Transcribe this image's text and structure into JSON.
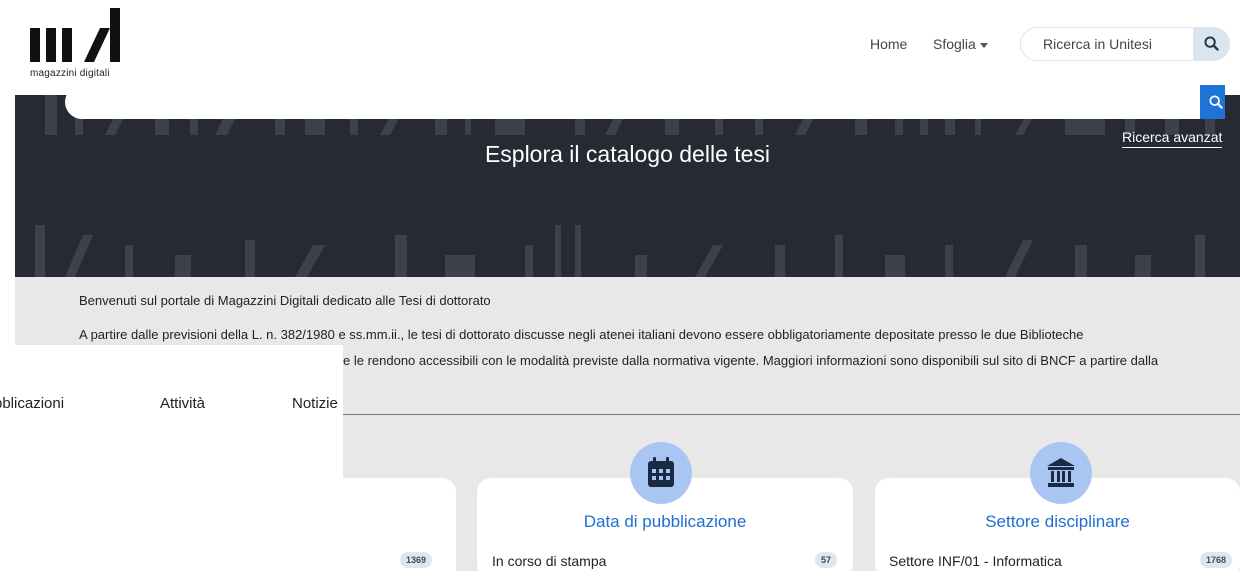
{
  "header": {
    "logo_text": "magazzini  digitali",
    "nav": {
      "home": "Home",
      "sfoglia": "Sfoglia"
    },
    "search_placeholder": "Ricerca in Unitesi"
  },
  "hero": {
    "title": "Esplora il catalogo delle tesi",
    "search_value": "",
    "advanced_link": "Ricerca avanzat"
  },
  "intro": {
    "line1": "Benvenuti sul portale di Magazzini Digitali dedicato alle Tesi di dottorato",
    "line2": "A partire dalle previsioni della L. n. 382/1980 e ss.mm.ii., le tesi di dottorato discusse negli atenei italiani devono essere obbligatoriamente depositate presso le due Biblioteche",
    "line3": "e le rendono accessibili con le modalità previste dalla normativa vigente. Maggiori informazioni sono disponibili sul sito di BNCF a partire dalla"
  },
  "tabs": [
    "bblicazioni",
    "Attività",
    "Notizie"
  ],
  "cards": [
    {
      "title": "",
      "row_label": "",
      "count": "1369",
      "icon": ""
    },
    {
      "title": "Data di pubblicazione",
      "row_label": "In corso di stampa",
      "count": "57",
      "icon": "calendar-icon"
    },
    {
      "title": "Settore disciplinare",
      "row_label": "Settore INF/01 - Informatica",
      "count": "1768",
      "icon": "institution-icon"
    }
  ],
  "colors": {
    "hero_bg": "#272a33",
    "accent": "#1e73d6",
    "link": "#1e6fd1",
    "icon_circle": "#a9c6f2",
    "intro_bg": "#e8e8e8"
  }
}
